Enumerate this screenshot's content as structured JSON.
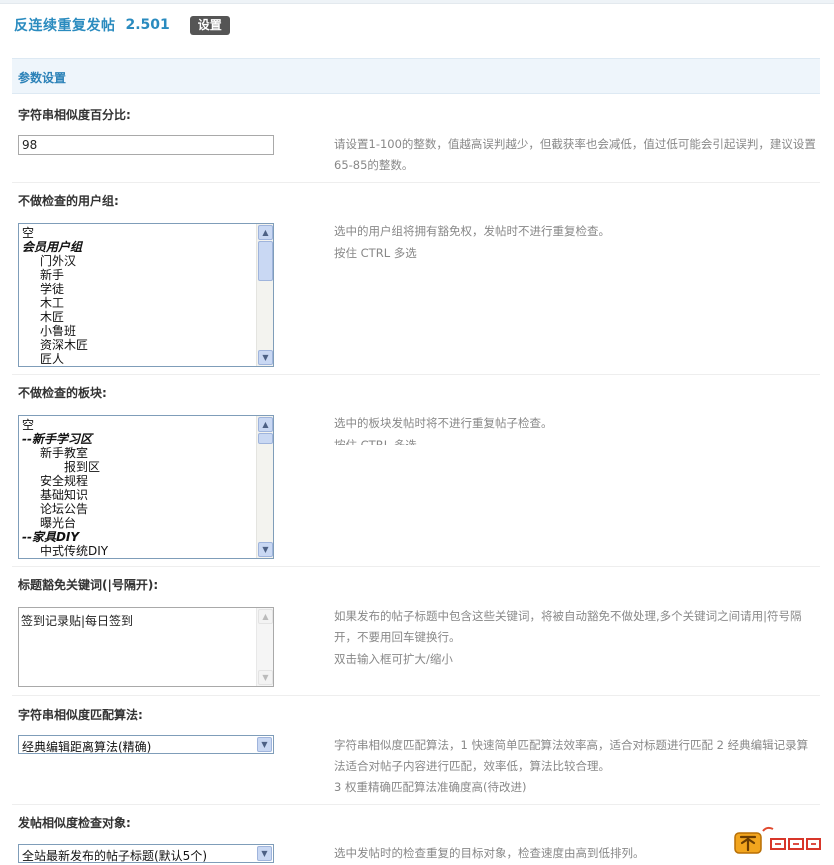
{
  "header": {
    "title": "反连续重复发帖",
    "version": "2.501",
    "settings_btn": "设置"
  },
  "section": {
    "title": "参数设置"
  },
  "fields": {
    "similarity": {
      "label": "字符串相似度百分比:",
      "value": "98",
      "desc": "请设置1-100的整数，值越高误判越少，但截获率也会减低，值过低可能会引起误判，建议设置65-85的整数。"
    },
    "user_groups": {
      "label": "不做检查的用户组:",
      "options": [
        "空",
        "会员用户组",
        "门外汉",
        "新手",
        "学徒",
        "木工",
        "木匠",
        "小鲁班",
        "资深木匠",
        "匠人"
      ],
      "desc1": "选中的用户组将拥有豁免权，发帖时不进行重复检查。",
      "desc2": "按住 CTRL 多选"
    },
    "forums": {
      "label": "不做检查的板块:",
      "options": [
        "空",
        "--新手学习区",
        "新手教室",
        "报到区",
        "安全规程",
        "基础知识",
        "论坛公告",
        "曝光台",
        "--家具DIY",
        "中式传统DIY"
      ],
      "desc1": "选中的板块发帖时将不进行重复帖子检查。",
      "desc2": "按住 CTRL 多选"
    },
    "keywords": {
      "label": "标题豁免关键词(|号隔开):",
      "value": "签到记录贴|每日签到",
      "desc1": "如果发布的帖子标题中包含这些关键词，将被自动豁免不做处理,多个关键词之间请用|符号隔开，不要用回车键换行。",
      "desc2": "双击输入框可扩大/缩小"
    },
    "algorithm": {
      "label": "字符串相似度匹配算法:",
      "value": "经典编辑距离算法(精确)",
      "desc1": "字符串相似度匹配算法，1 快速简单匹配算法效率高，适合对标题进行匹配 2 经典编辑记录算法适合对帖子内容进行匹配，效率低，算法比较合理。",
      "desc2": "3 权重精确匹配算法准确度高(待改进)"
    },
    "target": {
      "label": "发帖相似度检查对象:",
      "value": "全站最新发布的帖子标题(默认5个)",
      "desc": "选中发帖时的检查重复的目标对象，检查速度由高到低排列。"
    }
  },
  "icons": {
    "arrow_up": "▲",
    "arrow_down": "▼",
    "logo": "site-logo"
  },
  "colors": {
    "accent": "#2a8bbf",
    "section_bg": "#eef5fb",
    "button_bg": "#555555"
  }
}
